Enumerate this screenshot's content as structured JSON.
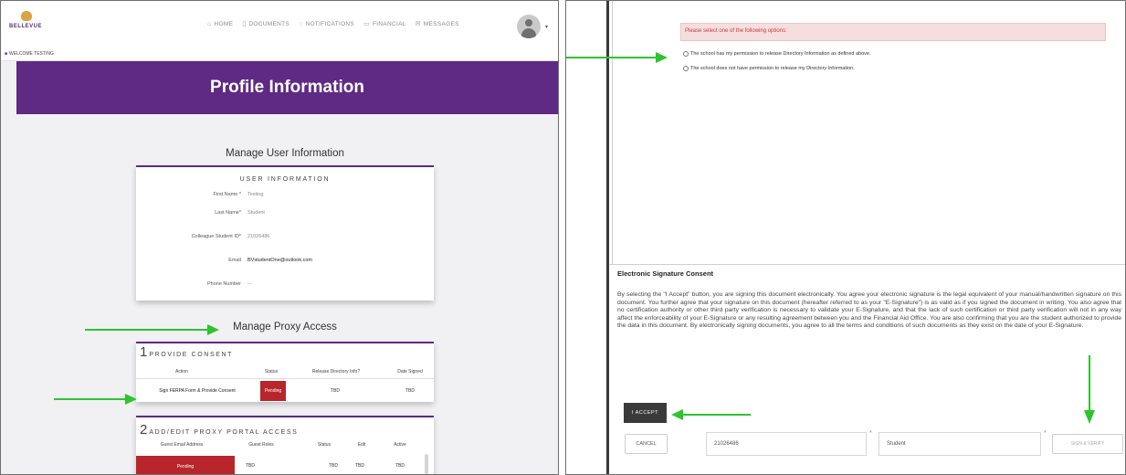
{
  "portal": {
    "logo_text": "BELLEVUE",
    "welcome": "WELCOME TESTING",
    "nav": [
      {
        "glyph": "⌂",
        "label": "HOME"
      },
      {
        "glyph": "▯",
        "label": "DOCUMENTS"
      },
      {
        "glyph": "◌",
        "label": "NOTIFICATIONS"
      },
      {
        "glyph": "▭",
        "label": "FINANCIAL"
      },
      {
        "glyph": "✉",
        "label": "MESSAGES"
      }
    ],
    "banner_title": "Profile Information"
  },
  "user_info": {
    "section_title": "Manage User Information",
    "card_heading": "USER INFORMATION",
    "rows": [
      {
        "label": "First Name *",
        "value": "Testing"
      },
      {
        "label": "Last Name*",
        "value": "Student"
      },
      {
        "label": "Colleague Student ID*",
        "value": "21026486"
      },
      {
        "label": "Email",
        "value": "BVstudentOne@outlook.com"
      },
      {
        "label": "Phone Number",
        "value": "---"
      }
    ]
  },
  "proxy": {
    "section_title": "Manage Proxy Access",
    "consent": {
      "number": "1",
      "title": "PROVIDE CONSENT",
      "headers": [
        "Action",
        "Status",
        "Release Directory Info?",
        "Date Signed"
      ],
      "row": {
        "action": "Sign FERPA Form & Provide Consent",
        "status": "Pending",
        "release": "TBD",
        "date": "TBD"
      }
    },
    "portal_access": {
      "number": "2",
      "title": "ADD/EDIT PROXY PORTAL ACCESS",
      "headers": [
        "Guest Email Address",
        "Guest Roles",
        "Status",
        "Edit",
        "Active"
      ],
      "row": {
        "email": "Pending",
        "roles": "TBD",
        "status": "TBD",
        "edit": "TBD",
        "active": "TBD"
      }
    }
  },
  "consent_form": {
    "error_message": "Please select one of the following options:",
    "options": [
      "The school has my permission to release Directory Information as defined above.",
      "The school does not have permission to release my Directory Information."
    ],
    "esig_title": "Electronic Signature Consent",
    "esig_body": "By selecting the \"I Accept\" button, you are signing this document electronically. You agree your electronic signature is the legal equivalent of your manual/handwritten signature on this document. You further agree that your signature on this document (hereafter referred to as your \"E-Signature\") is as valid as if you signed the document in writing. You also agree that no certification authority or other third party verification is necessary to validate your E-Signature, and that the lack of such certification or third party verification will not in any way affect the enforceability of your E-Signature or any resulting agreement between you and the Financial Aid Office. You are also confirming that you are the student authorized to provide the data in this document. By electronically signing documents, you agree to all the terms and conditions of such documents as they exist on the date of your E-Signature.",
    "accept_label": "I ACCEPT",
    "cancel_label": "CANCEL",
    "student_id": "21026486",
    "last_name": "Student",
    "sign_label": "SIGN & VERIFY"
  },
  "colors": {
    "brand_purple": "#5e2a84",
    "pending_red": "#b8262b",
    "arrow_green": "#2ec42e"
  }
}
